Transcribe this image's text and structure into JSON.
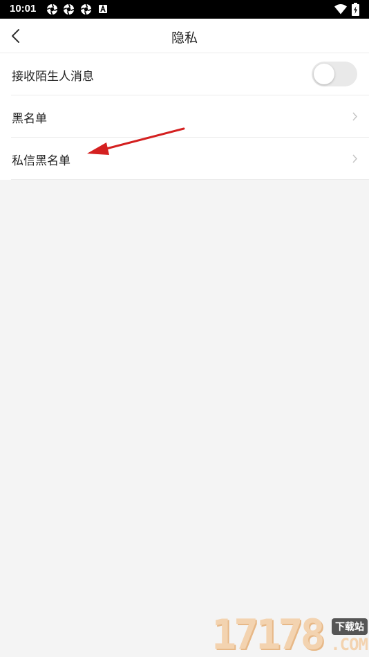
{
  "status_bar": {
    "time": "10:01",
    "notification_icons": [
      "aperture-icon",
      "aperture-icon",
      "aperture-icon",
      "a-square-icon"
    ],
    "right_icons": [
      "wifi-icon",
      "battery-charging-icon"
    ]
  },
  "header": {
    "title": "隐私",
    "back_icon": "chevron-left-icon"
  },
  "settings": {
    "items": [
      {
        "label": "接收陌生人消息",
        "control": "toggle",
        "toggle_on": false
      },
      {
        "label": "黑名单",
        "control": "chevron"
      },
      {
        "label": "私信黑名单",
        "control": "chevron"
      }
    ]
  },
  "annotation": {
    "type": "red-arrow",
    "color": "#d42020"
  },
  "watermark": {
    "digits": "17178",
    "badge": "下载站",
    "suffix": ".COM"
  },
  "colors": {
    "background": "#f4f4f4",
    "toggle_off": "#e9e9e9",
    "divider": "#ececec"
  }
}
